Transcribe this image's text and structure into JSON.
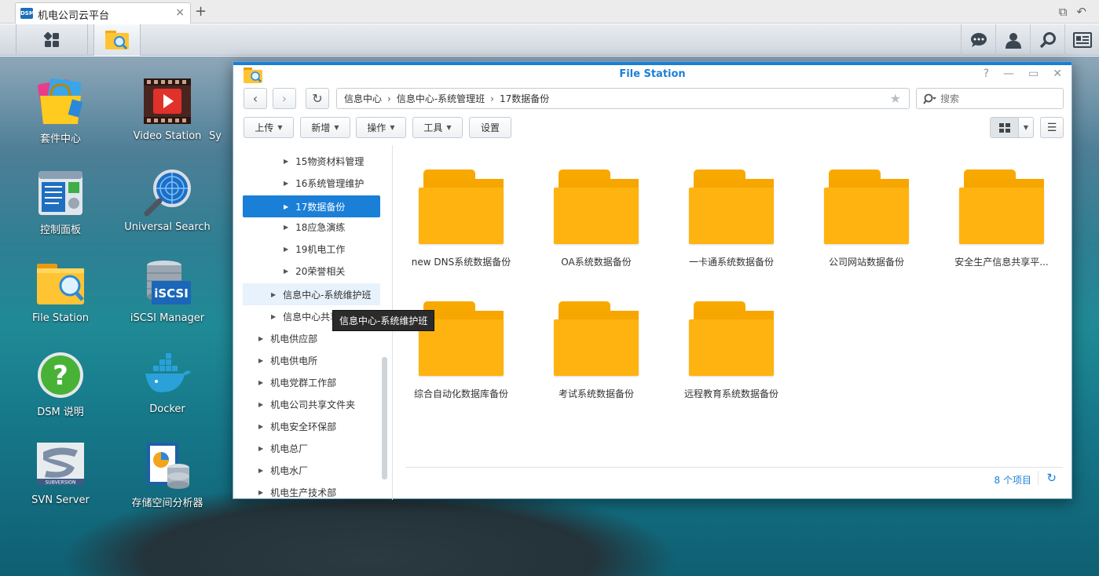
{
  "browser": {
    "tab_title": "机电公司云平台",
    "favicon_text": "DSM",
    "new_tab": "+",
    "close": "×"
  },
  "taskbar": {
    "icons": [
      "main-menu-icon",
      "file-station-icon",
      "chat-icon",
      "user-icon",
      "search-icon",
      "widgets-icon"
    ]
  },
  "desktop": {
    "icons": [
      {
        "label": "套件中心",
        "icon": "package-center-icon"
      },
      {
        "label": "Video Station",
        "icon": "video-station-icon"
      },
      {
        "label": "Sy",
        "icon": "partial-icon"
      },
      {
        "label": "控制面板",
        "icon": "control-panel-icon"
      },
      {
        "label": "Universal Search",
        "icon": "universal-search-icon"
      },
      {
        "label": "File Station",
        "icon": "file-station-icon"
      },
      {
        "label": "iSCSI Manager",
        "icon": "iscsi-manager-icon"
      },
      {
        "label": "DSM 说明",
        "icon": "dsm-help-icon"
      },
      {
        "label": "Docker",
        "icon": "docker-icon"
      },
      {
        "label": "SVN Server",
        "icon": "svn-server-icon"
      },
      {
        "label": "存储空间分析器",
        "icon": "storage-analyzer-icon"
      }
    ],
    "iscsi_text": "iSCSI",
    "svn_text": "SUBVERSION"
  },
  "window": {
    "title": "File Station",
    "controls": [
      "?",
      "—",
      "▭",
      "✕"
    ],
    "path": [
      "信息中心",
      "信息中心-系统管理班",
      "17数据备份"
    ],
    "search_placeholder": "搜索",
    "toolbar": {
      "upload": "上传",
      "new": "新增",
      "action": "操作",
      "tools": "工具",
      "settings": "设置"
    },
    "tree": [
      {
        "label": "15物资材料管理",
        "level": 2,
        "selected": false
      },
      {
        "label": "16系统管理维护",
        "level": 2,
        "selected": false
      },
      {
        "label": "17数据备份",
        "level": 2,
        "selected": true
      },
      {
        "label": "18应急演练",
        "level": 2,
        "selected": false
      },
      {
        "label": "19机电工作",
        "level": 2,
        "selected": false
      },
      {
        "label": "20荣誉相关",
        "level": 2,
        "selected": false
      },
      {
        "label": "信息中心-系统维护班",
        "level": 1,
        "selected": false
      },
      {
        "label": "信息中心共享",
        "level": 1,
        "selected": false
      },
      {
        "label": "机电供应部",
        "level": 0,
        "selected": false
      },
      {
        "label": "机电供电所",
        "level": 0,
        "selected": false
      },
      {
        "label": "机电党群工作部",
        "level": 0,
        "selected": false
      },
      {
        "label": "机电公司共享文件夹",
        "level": 0,
        "selected": false
      },
      {
        "label": "机电安全环保部",
        "level": 0,
        "selected": false
      },
      {
        "label": "机电总厂",
        "level": 0,
        "selected": false
      },
      {
        "label": "机电水厂",
        "level": 0,
        "selected": false
      },
      {
        "label": "机电生产技术部",
        "level": 0,
        "selected": false
      }
    ],
    "tooltip": "信息中心-系统维护班",
    "folders": [
      "new DNS系统数据备份",
      "OA系统数据备份",
      "一卡通系统数据备份",
      "公司网站数据备份",
      "安全生产信息共享平...",
      "综合自动化数据库备份",
      "考试系统数据备份",
      "远程教育系统数据备份"
    ],
    "status": "8 个项目"
  },
  "colors": {
    "accent": "#1a7fd7",
    "folder": "#ffb310",
    "selected_bg": "#1a7fd7"
  }
}
